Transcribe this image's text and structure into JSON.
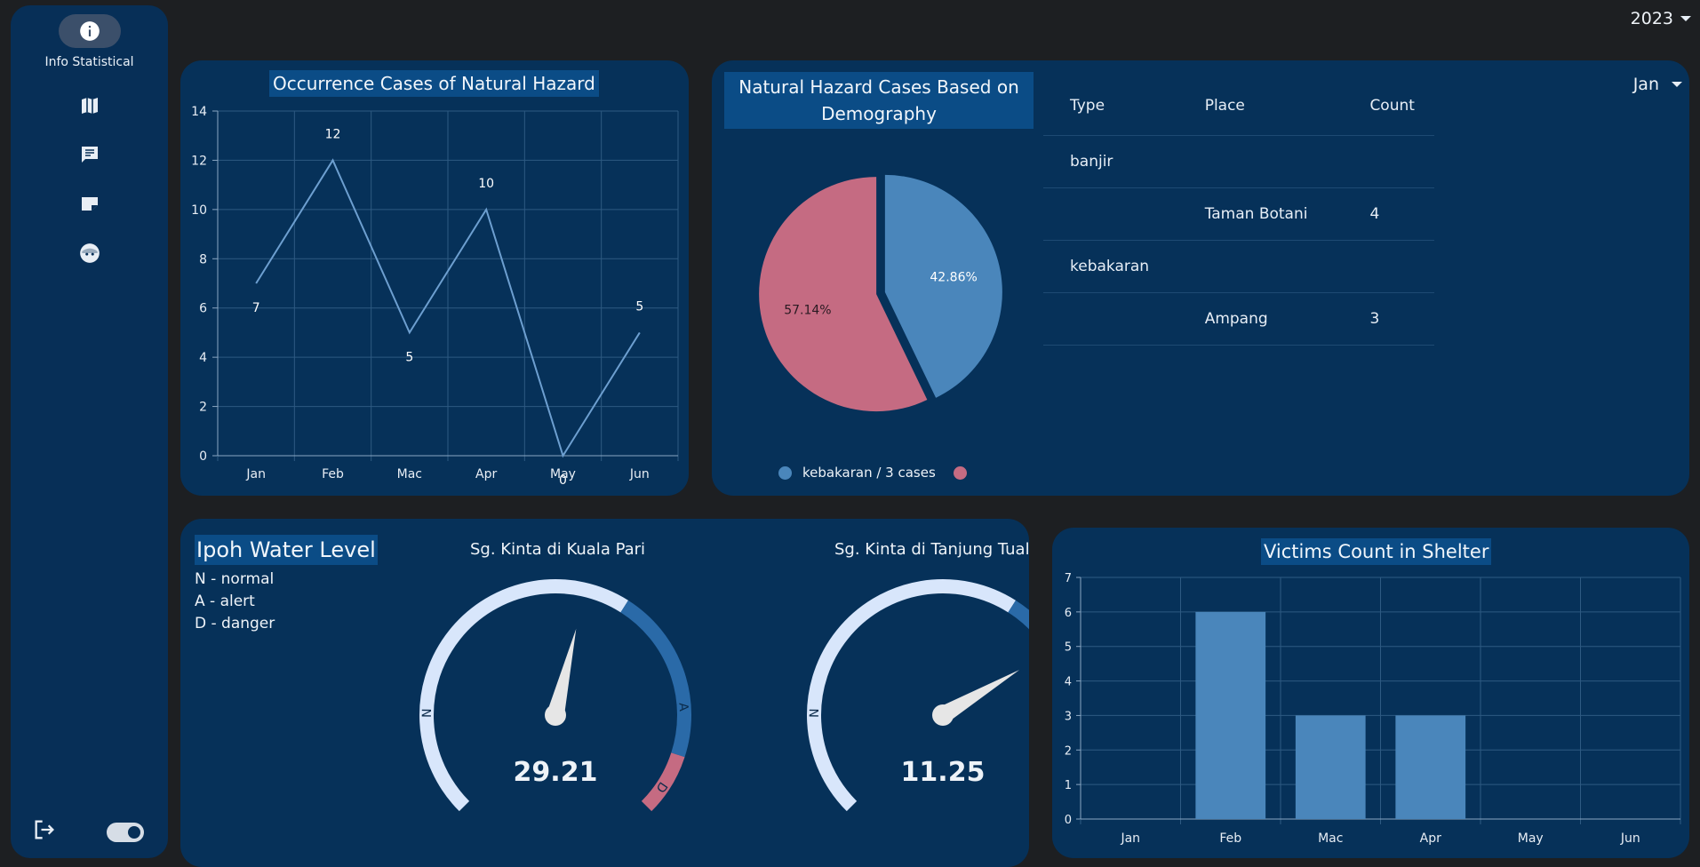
{
  "sidebar": {
    "active_label": "Info Statistical",
    "items": [
      {
        "icon": "info-icon"
      },
      {
        "icon": "map-icon"
      },
      {
        "icon": "chat-icon"
      },
      {
        "icon": "note-icon"
      },
      {
        "icon": "face-icon"
      }
    ],
    "logout_icon": "logout-icon",
    "toggle_state": "on"
  },
  "year_select": {
    "value": "2023"
  },
  "colors": {
    "background": "#1d1f22",
    "card": "#063159",
    "title_highlight": "#0b4c86",
    "series_blue": "#4a86bb",
    "series_pink": "#c56b82",
    "gauge_track": "#d8e6fb"
  },
  "occurrence": {
    "chart_data": {
      "type": "line",
      "title": "Occurrence Cases of Natural Hazard",
      "categories": [
        "Jan",
        "Feb",
        "Mac",
        "Apr",
        "May",
        "Jun"
      ],
      "values": [
        7,
        12,
        5,
        10,
        0,
        5
      ],
      "ylim": [
        0,
        14
      ],
      "yticks": [
        "0",
        "2",
        "4",
        "6",
        "8",
        "10",
        "12",
        "14"
      ],
      "grid": true
    }
  },
  "demography": {
    "chart_data": {
      "type": "pie",
      "title": "Natural Hazard Cases Based on Demography",
      "slices": [
        {
          "name": "banjir",
          "value": 42.86,
          "label": "42.86%",
          "color": "#4a86bb"
        },
        {
          "name": "kebakaran",
          "value": 57.14,
          "label": "57.14%",
          "color": "#c56b82"
        }
      ],
      "legend_text": "kebakaran / 3 cases"
    },
    "table": {
      "headers": [
        "Type",
        "Place",
        "Count"
      ],
      "rows": [
        [
          "banjir",
          "",
          ""
        ],
        [
          "",
          "Taman Botani",
          "4"
        ],
        [
          "kebakaran",
          "",
          ""
        ],
        [
          "",
          "Ampang",
          "3"
        ]
      ]
    },
    "month_select": {
      "value": "Jan"
    }
  },
  "water": {
    "title": "Ipoh Water Level",
    "legend": [
      "N - normal",
      "A - alert",
      "D - danger"
    ],
    "gauges": [
      {
        "name": "Sg. Kinta di Kuala Pari",
        "value": "29.21",
        "level": 0.55
      },
      {
        "name": "Sg. Kinta di Tanjung Tualang",
        "value": "11.25",
        "level": 0.72
      }
    ],
    "zone_labels": {
      "normal": "N",
      "alert": "A",
      "danger": "D"
    }
  },
  "shelter": {
    "chart_data": {
      "type": "bar",
      "title": "Victims Count in Shelter",
      "categories": [
        "Jan",
        "Feb",
        "Mac",
        "Apr",
        "May",
        "Jun"
      ],
      "values": [
        0,
        6,
        3,
        3,
        0,
        0
      ],
      "ylim": [
        0,
        7
      ],
      "yticks": [
        "0",
        "1",
        "2",
        "3",
        "4",
        "5",
        "6",
        "7"
      ],
      "grid": true
    }
  }
}
